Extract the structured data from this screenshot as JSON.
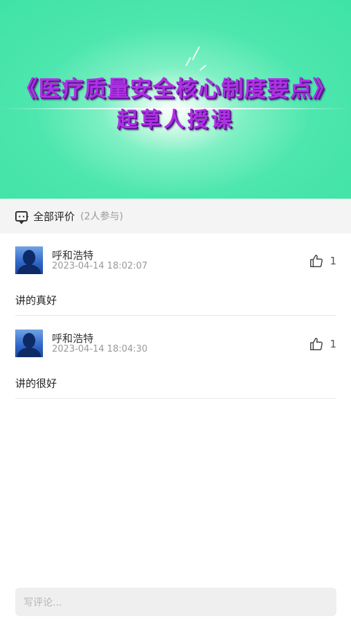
{
  "banner": {
    "title_line1": "《医疗质量安全核心制度要点》",
    "title_line2": "起草人授课"
  },
  "comments_section": {
    "label": "全部评价",
    "participants": "(2人参与)",
    "icon": "comment-icon"
  },
  "comments": [
    {
      "user": "呼和浩特",
      "time": "2023-04-14 18:02:07",
      "likes": "1",
      "text": "讲的真好"
    },
    {
      "user": "呼和浩特",
      "time": "2023-04-14 18:04:30",
      "likes": "1",
      "text": "讲的很好"
    }
  ],
  "input": {
    "placeholder": "写评论..."
  },
  "colors": {
    "banner_bg": "#3fe3a6",
    "title_purple": "#b030e6"
  }
}
